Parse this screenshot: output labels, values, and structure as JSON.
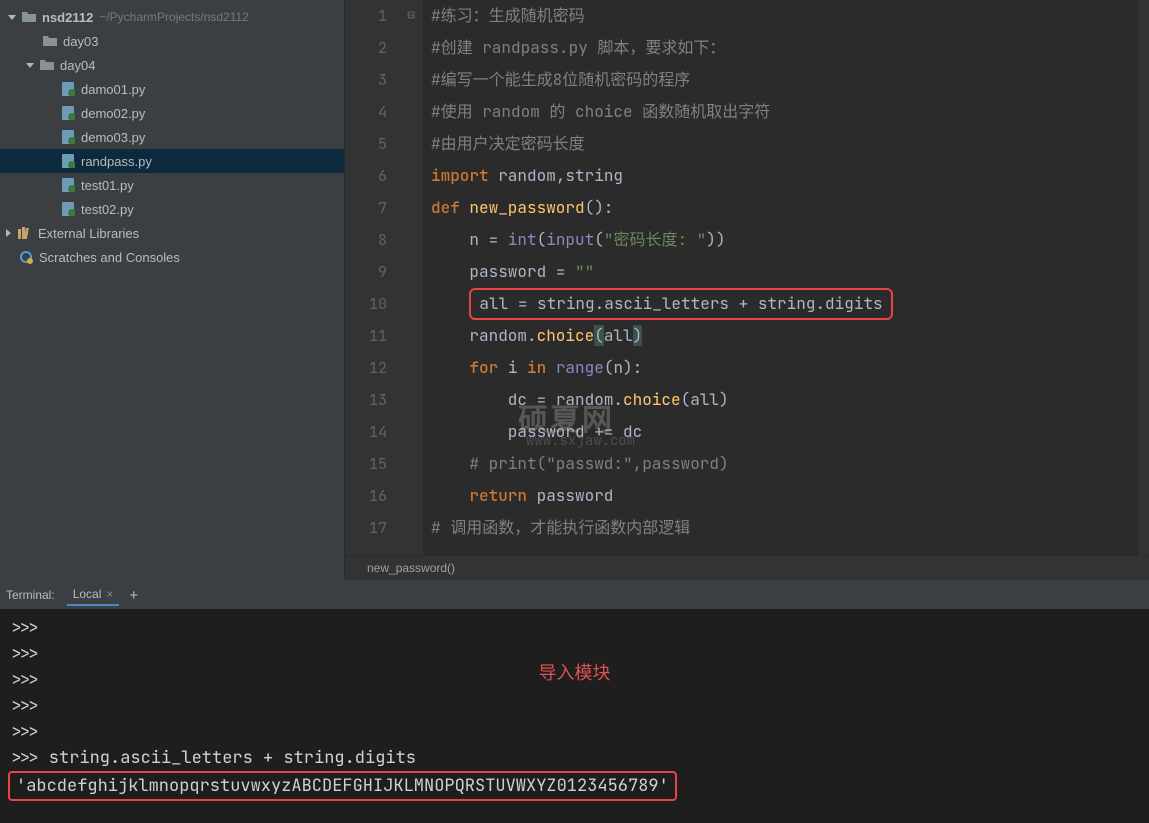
{
  "sidebar": {
    "project": {
      "name": "nsd2112",
      "path": "~/PycharmProjects/nsd2112"
    },
    "items": [
      {
        "label": "day03",
        "indent": 42,
        "kind": "folder",
        "arrow": "none"
      },
      {
        "label": "day04",
        "indent": 26,
        "kind": "folder",
        "arrow": "down"
      },
      {
        "label": "damo01.py",
        "indent": 60,
        "kind": "py"
      },
      {
        "label": "demo02.py",
        "indent": 60,
        "kind": "py"
      },
      {
        "label": "demo03.py",
        "indent": 60,
        "kind": "py"
      },
      {
        "label": "randpass.py",
        "indent": 60,
        "kind": "py",
        "selected": true
      },
      {
        "label": "test01.py",
        "indent": 60,
        "kind": "py"
      },
      {
        "label": "test02.py",
        "indent": 60,
        "kind": "py"
      }
    ],
    "external": "External Libraries",
    "scratches": "Scratches and Consoles"
  },
  "editor": {
    "lines": [
      {
        "n": 1,
        "seg": [
          [
            "comment",
            "#练习：生成随机密码"
          ]
        ]
      },
      {
        "n": 2,
        "seg": [
          [
            "comment",
            "#创建 randpass.py 脚本，要求如下："
          ]
        ]
      },
      {
        "n": 3,
        "seg": [
          [
            "comment",
            "#编写一个能生成8位随机密码的程序"
          ]
        ]
      },
      {
        "n": 4,
        "seg": [
          [
            "comment",
            "#使用 random 的 choice 函数随机取出字符"
          ]
        ]
      },
      {
        "n": 5,
        "seg": [
          [
            "comment",
            "#由用户决定密码长度"
          ]
        ]
      },
      {
        "n": 6,
        "seg": [
          [
            "keyword",
            "import "
          ],
          [
            "ident",
            "random"
          ],
          [
            "op",
            ","
          ],
          [
            "ident",
            "string"
          ]
        ]
      },
      {
        "n": 7,
        "seg": [
          [
            "keyword",
            "def "
          ],
          [
            "func",
            "new_password"
          ],
          [
            "op",
            "():"
          ]
        ]
      },
      {
        "n": 8,
        "seg": [
          [
            "ident",
            "    n "
          ],
          [
            "op",
            "= "
          ],
          [
            "builtin",
            "int"
          ],
          [
            "op",
            "("
          ],
          [
            "builtin",
            "input"
          ],
          [
            "op",
            "("
          ],
          [
            "string",
            "\"密码长度: \""
          ],
          [
            "op",
            "))"
          ]
        ]
      },
      {
        "n": 9,
        "seg": [
          [
            "ident",
            "    password "
          ],
          [
            "op",
            "= "
          ],
          [
            "string",
            "\"\""
          ]
        ]
      },
      {
        "n": 10,
        "redbox": true,
        "seg": [
          [
            "ident",
            "all"
          ],
          [
            "op",
            " = "
          ],
          [
            "ident",
            "string.ascii_letters "
          ],
          [
            "op",
            "+ "
          ],
          [
            "ident",
            "string.digits"
          ]
        ]
      },
      {
        "n": 11,
        "seg": [
          [
            "ident",
            "    random."
          ],
          [
            "func",
            "choice"
          ],
          [
            "hlopen",
            "("
          ],
          [
            "ident",
            "all"
          ],
          [
            "hlclose",
            ")"
          ]
        ]
      },
      {
        "n": 12,
        "seg": [
          [
            "ident",
            "    "
          ],
          [
            "keyword",
            "for "
          ],
          [
            "ident",
            "i "
          ],
          [
            "keyword",
            "in "
          ],
          [
            "builtin",
            "range"
          ],
          [
            "op",
            "(n):"
          ]
        ]
      },
      {
        "n": 13,
        "seg": [
          [
            "ident",
            "        dc "
          ],
          [
            "op",
            "= "
          ],
          [
            "ident",
            "random."
          ],
          [
            "func",
            "choice"
          ],
          [
            "op",
            "(all)"
          ]
        ]
      },
      {
        "n": 14,
        "seg": [
          [
            "ident",
            "        password "
          ],
          [
            "op",
            "+= "
          ],
          [
            "ident",
            "dc"
          ]
        ]
      },
      {
        "n": 15,
        "seg": [
          [
            "ident",
            "    "
          ],
          [
            "comment",
            "# print(\"passwd:\",password)"
          ]
        ]
      },
      {
        "n": 16,
        "seg": [
          [
            "ident",
            "    "
          ],
          [
            "keyword",
            "return "
          ],
          [
            "ident",
            "password"
          ]
        ]
      },
      {
        "n": 17,
        "seg": [
          [
            "comment",
            "# 调用函数，才能执行函数内部逻辑"
          ]
        ]
      }
    ],
    "breadcrumb": "new_password()",
    "watermark": "硕夏网",
    "watermark_url": "www.sxjaw.com"
  },
  "terminal": {
    "title": "Terminal:",
    "tab": "Local",
    "annotation": "导入模块",
    "lines": [
      ">>>",
      ">>>",
      ">>>",
      ">>>",
      ">>>",
      ">>> string.ascii_letters + string.digits"
    ],
    "result": "'abcdefghijklmnopqrstuvwxyzABCDEFGHIJKLMNOPQRSTUVWXYZ0123456789'"
  }
}
